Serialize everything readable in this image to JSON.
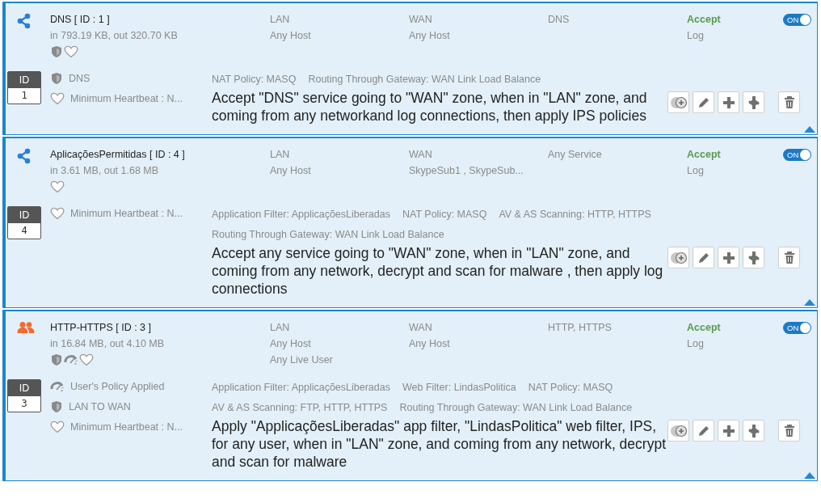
{
  "rules": [
    {
      "kind": "network",
      "name": "DNS [ ID : 1 ]",
      "traffic": "in 793.19 KB, out 320.70 KB",
      "status_marks": [
        {
          "kind": "shield"
        },
        {
          "kind": "heart"
        }
      ],
      "source": [
        "LAN",
        "Any Host"
      ],
      "destination": [
        "WAN",
        "Any Host"
      ],
      "services": [
        "DNS"
      ],
      "action": "Accept",
      "log": "Log",
      "enabled": true,
      "toggle_label": "ON",
      "id_label": "ID",
      "id_value": "1",
      "details": [
        {
          "kind": "shield",
          "text": "DNS"
        },
        {
          "kind": "heart",
          "text": "Minimum Heartbeat : N..."
        }
      ],
      "tag_rows": [
        [
          "NAT Policy: MASQ",
          "Routing Through Gateway: WAN Link Load Balance"
        ]
      ],
      "description": "Accept \"DNS\" service going to \"WAN\" zone, when in \"LAN\" zone, and coming from any networkand log connections, then apply IPS policies"
    },
    {
      "kind": "network",
      "name": "AplicaçõesPermitidas [ ID : 4 ]",
      "traffic": "in 3.61 MB, out 1.68 MB",
      "status_marks": [
        {
          "kind": "heart"
        }
      ],
      "source": [
        "LAN",
        "Any Host"
      ],
      "destination": [
        "WAN",
        "SkypeSub1 , SkypeSub..."
      ],
      "services": [
        "Any Service"
      ],
      "action": "Accept",
      "log": "Log",
      "enabled": true,
      "toggle_label": "ON",
      "id_label": "ID",
      "id_value": "4",
      "details": [
        {
          "kind": "heart",
          "text": "Minimum Heartbeat : N..."
        }
      ],
      "tag_rows": [
        [
          "Application Filter: ApplicaçõesLiberadas",
          "NAT Policy: MASQ",
          "AV & AS Scanning: HTTP, HTTPS"
        ],
        [
          "Routing Through Gateway: WAN Link Load Balance"
        ]
      ],
      "description": "Accept any service going to \"WAN\" zone, when in \"LAN\" zone, and coming from any network, decrypt and scan for malware , then apply log connections"
    },
    {
      "kind": "user",
      "name": "HTTP-HTTPS [ ID : 3 ]",
      "traffic": "in 16.84 MB, out 4.10 MB",
      "status_marks": [
        {
          "kind": "shield"
        },
        {
          "kind": "gauge"
        },
        {
          "kind": "heart"
        }
      ],
      "source": [
        "LAN",
        "Any Host",
        "Any Live User"
      ],
      "destination": [
        "WAN",
        "Any Host"
      ],
      "services": [
        "HTTP, HTTPS"
      ],
      "action": "Accept",
      "log": "Log",
      "enabled": true,
      "toggle_label": "ON",
      "id_label": "ID",
      "id_value": "3",
      "details": [
        {
          "kind": "gauge",
          "text": "User's Policy Applied"
        },
        {
          "kind": "shield",
          "text": "LAN TO WAN"
        },
        {
          "kind": "heart",
          "text": "Minimum Heartbeat : N..."
        }
      ],
      "tag_rows": [
        [
          "Application Filter: ApplicaçõesLiberadas",
          "Web Filter: LindasPolitica",
          "NAT Policy: MASQ"
        ],
        [
          "AV & AS Scanning: FTP, HTTP, HTTPS",
          "Routing Through Gateway: WAN Link Load Balance"
        ]
      ],
      "description": "Apply \"ApplicaçõesLiberadas\" app filter, \"LindasPolitica\" web filter, IPS, for any user, when in \"LAN\" zone, and coming from any network, decrypt and scan for malware"
    }
  ]
}
